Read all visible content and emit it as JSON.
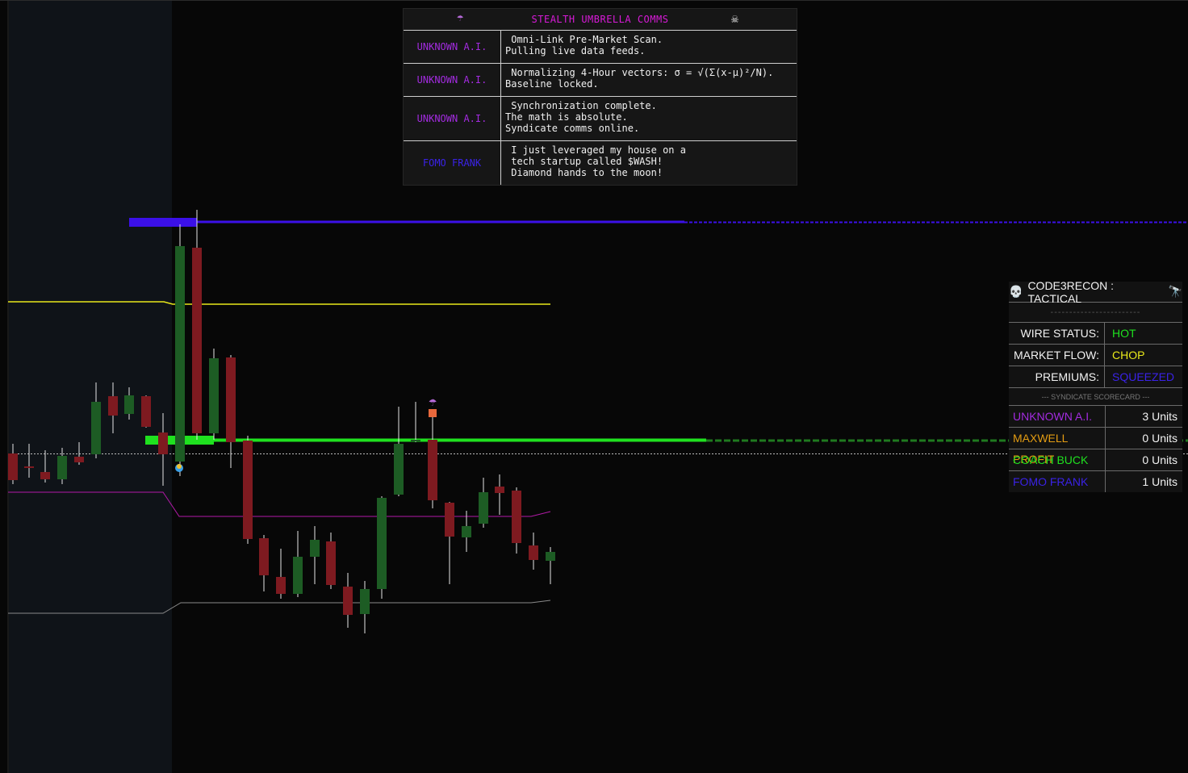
{
  "colors": {
    "background": "#070707",
    "session_shade": "#0f1318",
    "bull": "#1d5c24",
    "bear": "#7e1a20",
    "wick": "#e6e6e6",
    "upper_band": "#e8e81a",
    "mid_band": "#b31aa8",
    "lower_band": "#8a8a8a",
    "level_blue": "#3b10e8",
    "level_green": "#1fe11f"
  },
  "comms": {
    "title": "STEALTH UMBRELLA COMMS",
    "left_icon": "umbrella-icon",
    "left_glyph": "☂",
    "right_icon": "skull-crossbones-icon",
    "right_glyph": "☠",
    "rows": [
      {
        "sender": "UNKNOWN A.I.",
        "color": "#a32be0",
        "message": " Omni-Link Pre-Market Scan.\nPulling live data feeds."
      },
      {
        "sender": "UNKNOWN A.I.",
        "color": "#a32be0",
        "message": " Normalizing 4-Hour vectors: σ = √(Σ(x-μ)²/N).\nBaseline locked."
      },
      {
        "sender": "UNKNOWN A.I.",
        "color": "#a32be0",
        "message": " Synchronization complete.\nThe math is absolute.\nSyndicate comms online."
      },
      {
        "sender": "FOMO FRANK",
        "color": "#3a22e6",
        "message": " I just leveraged my house on a\n tech startup called $WASH!\n Diamond hands to the moon!"
      }
    ]
  },
  "tactical": {
    "title": "CODE3RECON : TACTICAL",
    "title_left_glyph": "💀",
    "title_right_glyph": "🔭",
    "separator": "------------------------",
    "status": [
      {
        "label": "WIRE STATUS:",
        "value": "HOT",
        "color": "#1fe11f"
      },
      {
        "label": "MARKET FLOW:",
        "value": "CHOP",
        "color": "#e8e81a"
      },
      {
        "label": "PREMIUMS:",
        "value": "SQUEEZED",
        "color": "#3a22e6"
      }
    ],
    "scorecard_title": "--- SYNDICATE SCORECARD ---",
    "scorecard": [
      {
        "name": "UNKNOWN A.I.",
        "units": "3 Units",
        "color": "#a32be0"
      },
      {
        "name": "MAXWELL PROFIT",
        "units": "0 Units",
        "color": "#e39c12"
      },
      {
        "name": "COACH BUCK",
        "units": "0 Units",
        "color": "#1fe11f"
      },
      {
        "name": "FOMO FRANK",
        "units": "1 Units",
        "color": "#3a22e6"
      }
    ]
  },
  "markers": {
    "umbrella_glyph": "☂",
    "face_glyph": "🤯",
    "dollar_glyph": "💲"
  }
}
